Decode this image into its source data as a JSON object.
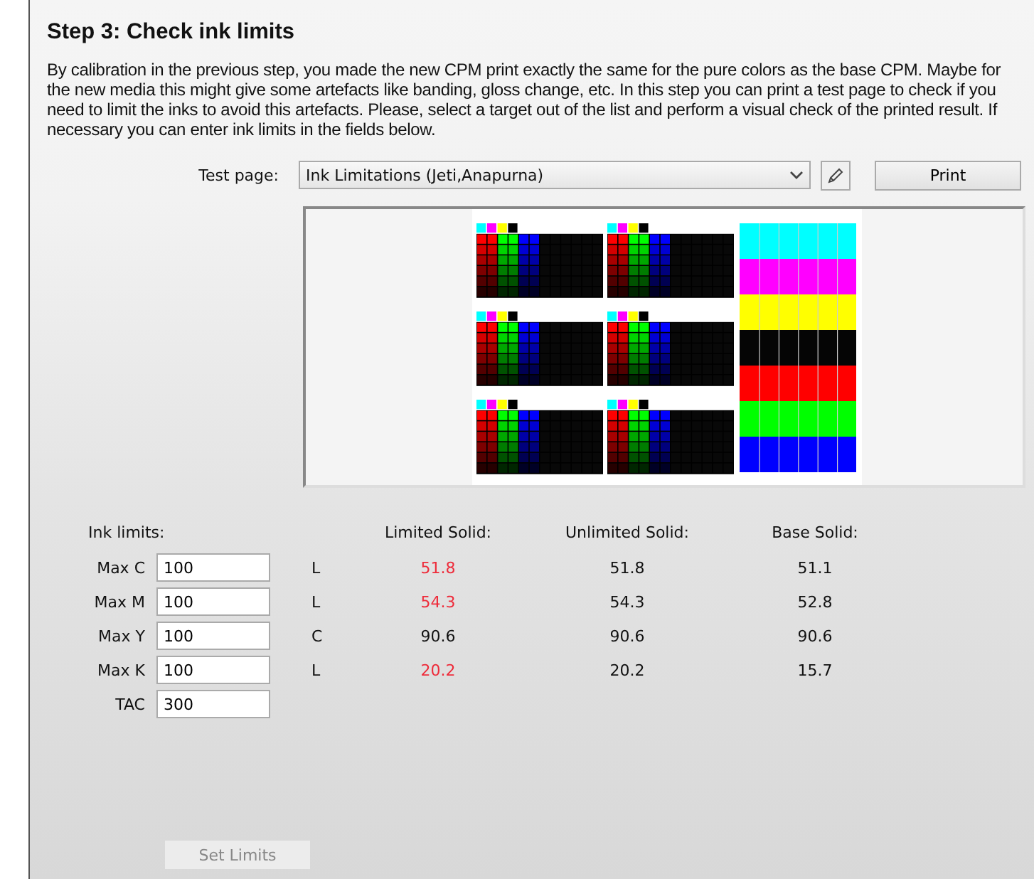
{
  "title": "Step 3: Check ink limits",
  "description": "By calibration in the previous step, you made the new CPM print exactly the same for the pure colors as the base CPM. Maybe for the new media this might give some artefacts like banding, gloss change, etc. In this step you can print a test page to check if you need to limit the inks to avoid this artefacts. Please, select a target out of the list and perform a visual check of the printed result. If necessary you can enter ink limits in the fields below.",
  "test_page": {
    "label": "Test page:",
    "value": "Ink Limitations (Jeti,Anapurna)"
  },
  "print_button": "Print",
  "ink_limits": {
    "label": "Ink limits:",
    "columns": [
      "Limited Solid:",
      "Unlimited Solid:",
      "Base Solid:"
    ],
    "rows": [
      {
        "label": "Max C",
        "value": "100",
        "flag": "L",
        "limited": "51.8",
        "highlighted": true,
        "unlimited": "51.8",
        "base": "51.1"
      },
      {
        "label": "Max M",
        "value": "100",
        "flag": "L",
        "limited": "54.3",
        "highlighted": true,
        "unlimited": "54.3",
        "base": "52.8"
      },
      {
        "label": "Max Y",
        "value": "100",
        "flag": "C",
        "limited": "90.6",
        "highlighted": false,
        "unlimited": "90.6",
        "base": "90.6"
      },
      {
        "label": "Max K",
        "value": "100",
        "flag": "L",
        "limited": "20.2",
        "highlighted": true,
        "unlimited": "20.2",
        "base": "15.7"
      },
      {
        "label": "TAC",
        "value": "300"
      }
    ]
  },
  "set_limits_button": {
    "label": "Set Limits",
    "disabled": true
  }
}
